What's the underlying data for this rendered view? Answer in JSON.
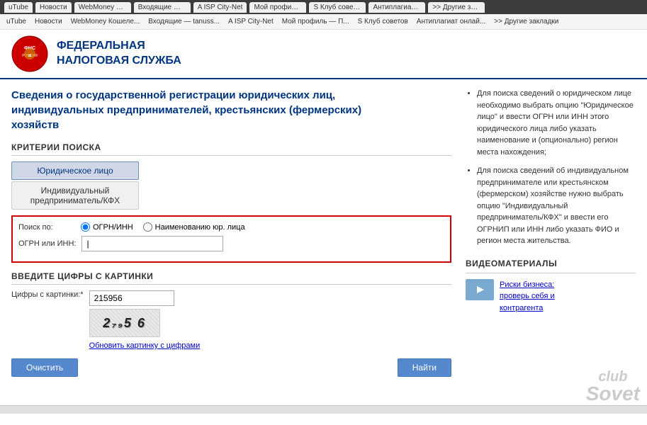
{
  "browser": {
    "tabs": [
      {
        "label": "uTube"
      },
      {
        "label": "Новости"
      },
      {
        "label": "WebMoney Кошеле..."
      },
      {
        "label": "Входящие — tanuss..."
      },
      {
        "label": "A ISP City-Net"
      },
      {
        "label": "Мой профиль — П..."
      },
      {
        "label": "S Клуб советов"
      },
      {
        "label": "Антиплагиат онлай..."
      },
      {
        "label": ">> Другие закладки"
      }
    ],
    "address": "https://egrul.nalog.ru/",
    "bookmarks": [
      "uTube",
      "Новости",
      "WebMoney Кошеле...",
      "Входящие — tanuss...",
      "A ISP City-Net",
      "Мой профиль — П...",
      "S Клуб советов",
      "Антиплагиат онлай...",
      ">> Другие закладки"
    ]
  },
  "header": {
    "logo_alt": "ФНС логотип",
    "title_line1": "ФЕДЕРАЛЬНАЯ",
    "title_line2": "НАЛОГОВАЯ СЛУЖБА"
  },
  "page": {
    "heading": "Сведения о государственной регистрации юридических лиц,\nиндивидуальных предпринимателей, крестьянских (фермерских)\nхозяйств"
  },
  "search": {
    "section_title": "КРИТЕРИИ ПОИСКА",
    "tab_legal": "Юридическое лицо",
    "tab_individual": "Индивидуальный предприниматель/КФХ",
    "search_by_label": "Поиск по:",
    "radio_ogrn": "ОГРН/ИНН",
    "radio_name": "Наименованию юр. лица",
    "ogrn_label": "ОГРН или ИНН:",
    "ogrn_value": "",
    "ogrn_placeholder": ""
  },
  "captcha": {
    "section_title": "ВВЕДИТЕ ЦИФРЫ С КАРТИНКИ",
    "label": "Цифры с картинки:*",
    "value": "215956",
    "captcha_text": "2 5 6",
    "refresh_link": "Обновить картинку с цифрами"
  },
  "buttons": {
    "clear": "Очистить",
    "search": "Найти"
  },
  "info_panel": {
    "items": [
      "Для поиска сведений о юридическом лице необходимо выбрать опцию \"Юридическое лицо\" и ввести ОГРН или ИНН этого юридического лица либо указать наименование и (опционально) регион места нахождения;",
      "Для поиска сведений об индивидуальном предпринимателе или крестьянском (фермерском) хозяйстве нужно выбрать опцию \"Индивидуальный предприниматель/КФХ\" и ввести его ОГРНИП или ИНН либо указать ФИО и регион места жительства."
    ]
  },
  "video_section": {
    "title": "ВИДЕОМАТЕРИАЛЫ",
    "item_link": "Риски бизнеса:\nпроверь себя и\nконтрагента"
  },
  "watermark": {
    "line1": "club",
    "line2": "Sovet"
  }
}
